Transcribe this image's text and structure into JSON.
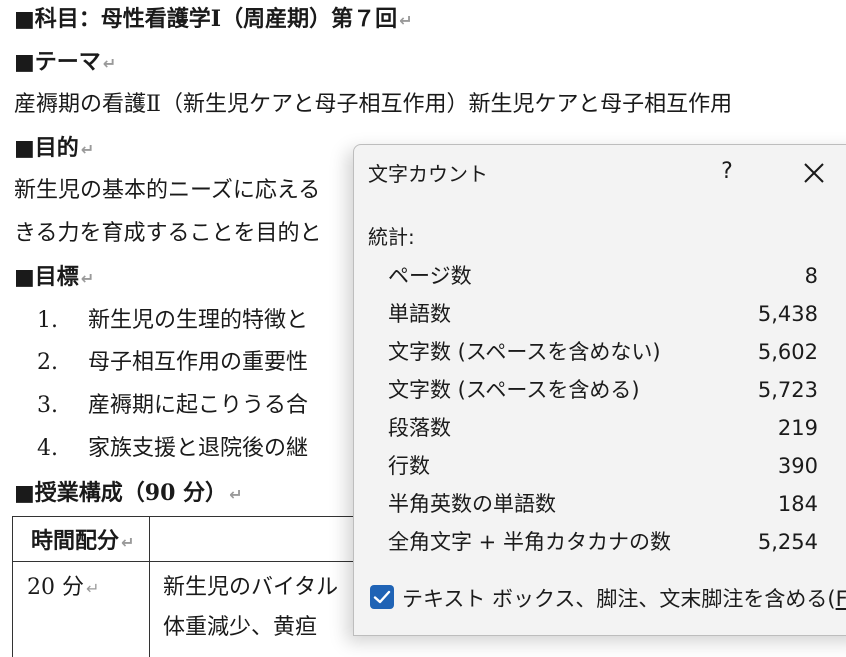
{
  "document": {
    "heading_subject": "■科目：母性看護学Ⅰ（周産期）第７回",
    "heading_theme": "■テーマ",
    "theme_text": "産褥期の看護Ⅱ（新生児ケアと母子相互作用）新生児ケアと母子相互作用",
    "heading_purpose": "■目的",
    "purpose_line1": "新生児の基本的ニーズに応える",
    "purpose_line2": "きる力を育成することを目的と",
    "heading_goals": "■目標",
    "goals": [
      {
        "num": "1.",
        "text": "新生児の生理的特徴と"
      },
      {
        "num": "2.",
        "text": "母子相互作用の重要性"
      },
      {
        "num": "3.",
        "text": "産褥期に起こりうる合"
      },
      {
        "num": "4.",
        "text": "家族支援と退院後の継"
      }
    ],
    "heading_structure": "■授業構成（90 分）",
    "table": {
      "header_time": "時間配分",
      "row1_time": "20 分",
      "row1_content": "新生児のバイタル",
      "row1_content2": "体重減少、黄疸"
    },
    "paragraph_mark": "↵"
  },
  "dialog": {
    "title": "文字カウント",
    "help_label": "?",
    "section_label": "統計:",
    "stats": [
      {
        "label": "ページ数",
        "value": "8"
      },
      {
        "label": "単語数",
        "value": "5,438"
      },
      {
        "label": "文字数 (スペースを含めない)",
        "value": "5,602"
      },
      {
        "label": "文字数 (スペースを含める)",
        "value": "5,723"
      },
      {
        "label": "段落数",
        "value": "219"
      },
      {
        "label": "行数",
        "value": "390"
      },
      {
        "label": "半角英数の単語数",
        "value": "184"
      },
      {
        "label": "全角文字 + 半角カタカナの数",
        "value": "5,254"
      }
    ],
    "checkbox_label": "テキスト ボックス、脚注、文末脚注を含める(",
    "checkbox_accel": "F",
    "checkbox_end": ")",
    "checkbox_checked": true,
    "accent_color": "#1f63b5"
  }
}
